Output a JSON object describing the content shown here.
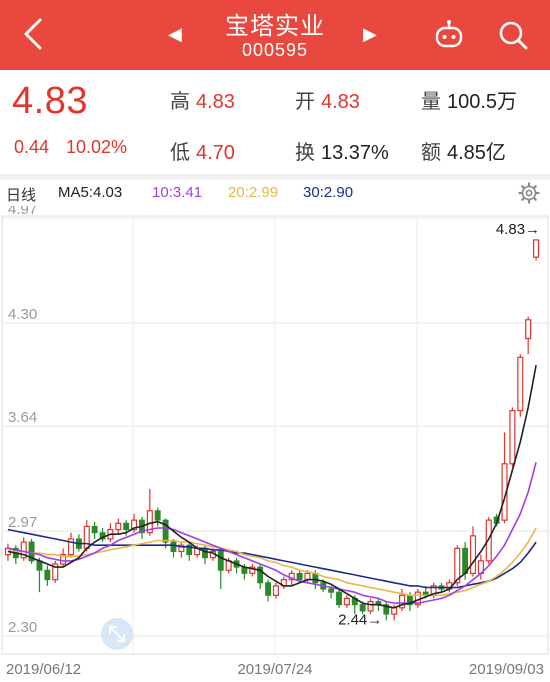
{
  "header": {
    "title": "宝塔实业",
    "code": "000595",
    "prev_glyph": "◀",
    "next_glyph": "▶",
    "icons": [
      "back-arrow-icon",
      "robot-icon",
      "search-icon"
    ],
    "bg_color": "#e8483d"
  },
  "quote": {
    "price": "4.83",
    "change": "0.44",
    "change_pct": "10.02%",
    "high_label": "高",
    "high": "4.83",
    "open_label": "开",
    "open": "4.83",
    "volume_label": "量",
    "volume": "100.5万",
    "low_label": "低",
    "low": "4.70",
    "turnover_label": "换",
    "turnover": "13.37%",
    "amount_label": "额",
    "amount": "4.85亿",
    "up_color": "#e0362b"
  },
  "legend": {
    "period": "日线",
    "ma5": "MA5:4.03",
    "ma10": "10:3.41",
    "ma20": "20:2.99",
    "ma30": "30:2.90",
    "colors": {
      "ma5": "#222222",
      "ma10": "#a23ee8",
      "ma20": "#e8b64a",
      "ma30": "#1e2a8a"
    }
  },
  "chart_data": {
    "type": "candlestick",
    "y_ticks": [
      "4.97",
      "4.30",
      "3.64",
      "2.97",
      "2.30"
    ],
    "ylim": [
      2.3,
      4.97
    ],
    "x_labels": [
      "2019/06/12",
      "2019/07/24",
      "2019/09/03"
    ],
    "annotations": {
      "max": "4.83→",
      "min": "2.44→"
    },
    "up_color": "#e0362b",
    "down_color": "#2a8a2a",
    "candles": [
      [
        2.82,
        2.86,
        2.78,
        2.89
      ],
      [
        2.86,
        2.8,
        2.76,
        2.88
      ],
      [
        2.8,
        2.9,
        2.78,
        2.93
      ],
      [
        2.9,
        2.78,
        2.76,
        2.92
      ],
      [
        2.78,
        2.72,
        2.58,
        2.8
      ],
      [
        2.72,
        2.66,
        2.62,
        2.75
      ],
      [
        2.66,
        2.76,
        2.64,
        2.78
      ],
      [
        2.76,
        2.82,
        2.74,
        2.86
      ],
      [
        2.82,
        2.92,
        2.8,
        2.96
      ],
      [
        2.92,
        2.86,
        2.84,
        2.95
      ],
      [
        2.86,
        3.0,
        2.84,
        3.04
      ],
      [
        3.0,
        2.96,
        2.92,
        3.03
      ],
      [
        2.96,
        2.92,
        2.9,
        2.99
      ],
      [
        2.92,
        2.98,
        2.9,
        3.02
      ],
      [
        2.98,
        3.02,
        2.95,
        3.05
      ],
      [
        3.02,
        2.98,
        2.94,
        3.04
      ],
      [
        2.98,
        3.04,
        2.96,
        3.08
      ],
      [
        3.04,
        2.96,
        2.92,
        3.06
      ],
      [
        2.96,
        3.1,
        2.94,
        3.24
      ],
      [
        3.1,
        3.04,
        3.0,
        3.12
      ],
      [
        3.04,
        2.9,
        2.86,
        3.05
      ],
      [
        2.9,
        2.84,
        2.8,
        2.92
      ],
      [
        2.84,
        2.88,
        2.8,
        2.9
      ],
      [
        2.88,
        2.82,
        2.78,
        2.9
      ],
      [
        2.82,
        2.86,
        2.8,
        2.88
      ],
      [
        2.86,
        2.8,
        2.76,
        2.88
      ],
      [
        2.8,
        2.84,
        2.78,
        2.86
      ],
      [
        2.84,
        2.72,
        2.6,
        2.86
      ],
      [
        2.72,
        2.78,
        2.7,
        2.8
      ],
      [
        2.78,
        2.74,
        2.7,
        2.8
      ],
      [
        2.74,
        2.7,
        2.66,
        2.76
      ],
      [
        2.7,
        2.74,
        2.68,
        2.76
      ],
      [
        2.74,
        2.64,
        2.6,
        2.76
      ],
      [
        2.64,
        2.56,
        2.52,
        2.66
      ],
      [
        2.56,
        2.62,
        2.54,
        2.64
      ],
      [
        2.62,
        2.66,
        2.6,
        2.68
      ],
      [
        2.66,
        2.7,
        2.62,
        2.72
      ],
      [
        2.7,
        2.66,
        2.64,
        2.72
      ],
      [
        2.66,
        2.7,
        2.64,
        2.72
      ],
      [
        2.7,
        2.64,
        2.6,
        2.72
      ],
      [
        2.64,
        2.6,
        2.58,
        2.66
      ],
      [
        2.6,
        2.58,
        2.54,
        2.62
      ],
      [
        2.58,
        2.5,
        2.48,
        2.6
      ],
      [
        2.5,
        2.54,
        2.48,
        2.56
      ],
      [
        2.54,
        2.5,
        2.44,
        2.56
      ],
      [
        2.5,
        2.46,
        2.44,
        2.52
      ],
      [
        2.46,
        2.52,
        2.44,
        2.54
      ],
      [
        2.52,
        2.5,
        2.46,
        2.54
      ],
      [
        2.5,
        2.44,
        2.4,
        2.52
      ],
      [
        2.44,
        2.48,
        2.4,
        2.5
      ],
      [
        2.48,
        2.56,
        2.46,
        2.6
      ],
      [
        2.56,
        2.5,
        2.46,
        2.58
      ],
      [
        2.5,
        2.58,
        2.48,
        2.6
      ],
      [
        2.58,
        2.56,
        2.54,
        2.62
      ],
      [
        2.56,
        2.62,
        2.54,
        2.64
      ],
      [
        2.62,
        2.6,
        2.58,
        2.64
      ],
      [
        2.6,
        2.64,
        2.58,
        2.66
      ],
      [
        2.64,
        2.86,
        2.62,
        2.88
      ],
      [
        2.86,
        2.7,
        2.66,
        2.9
      ],
      [
        2.7,
        2.94,
        2.68,
        3.0
      ],
      [
        2.7,
        2.78,
        2.66,
        2.82
      ],
      [
        2.78,
        3.04,
        2.76,
        3.06
      ],
      [
        3.06,
        3.02,
        3.0,
        3.08
      ],
      [
        3.04,
        3.4,
        3.02,
        3.6
      ],
      [
        3.4,
        3.74,
        3.38,
        3.76
      ],
      [
        3.74,
        4.08,
        3.7,
        4.1
      ],
      [
        4.2,
        4.32,
        4.1,
        4.34
      ],
      [
        4.72,
        4.83,
        4.7,
        4.83
      ]
    ],
    "ma5": [
      2.84,
      2.83,
      2.82,
      2.8,
      2.78,
      2.76,
      2.74,
      2.74,
      2.77,
      2.8,
      2.86,
      2.9,
      2.93,
      2.95,
      2.95,
      2.96,
      2.99,
      3.0,
      3.02,
      3.03,
      3.01,
      2.97,
      2.93,
      2.9,
      2.86,
      2.84,
      2.83,
      2.8,
      2.78,
      2.76,
      2.74,
      2.73,
      2.72,
      2.68,
      2.65,
      2.62,
      2.62,
      2.64,
      2.66,
      2.66,
      2.65,
      2.63,
      2.6,
      2.57,
      2.54,
      2.51,
      2.5,
      2.5,
      2.49,
      2.48,
      2.5,
      2.51,
      2.53,
      2.55,
      2.57,
      2.58,
      2.6,
      2.66,
      2.7,
      2.77,
      2.84,
      2.92,
      3.02,
      3.18,
      3.36,
      3.54,
      3.76,
      4.03
    ],
    "ma10": [
      2.86,
      2.85,
      2.84,
      2.83,
      2.82,
      2.8,
      2.79,
      2.78,
      2.78,
      2.79,
      2.81,
      2.83,
      2.86,
      2.88,
      2.91,
      2.93,
      2.95,
      2.97,
      2.98,
      2.99,
      2.99,
      2.98,
      2.96,
      2.94,
      2.92,
      2.9,
      2.88,
      2.86,
      2.84,
      2.82,
      2.8,
      2.78,
      2.76,
      2.74,
      2.72,
      2.69,
      2.67,
      2.65,
      2.64,
      2.63,
      2.62,
      2.61,
      2.6,
      2.59,
      2.58,
      2.56,
      2.55,
      2.54,
      2.52,
      2.51,
      2.51,
      2.51,
      2.51,
      2.52,
      2.53,
      2.54,
      2.56,
      2.59,
      2.62,
      2.66,
      2.7,
      2.75,
      2.81,
      2.88,
      2.98,
      3.08,
      3.22,
      3.41
    ],
    "ma20": [
      2.84,
      2.84,
      2.84,
      2.83,
      2.83,
      2.82,
      2.82,
      2.81,
      2.81,
      2.81,
      2.82,
      2.83,
      2.84,
      2.85,
      2.86,
      2.87,
      2.88,
      2.89,
      2.9,
      2.91,
      2.91,
      2.91,
      2.9,
      2.9,
      2.89,
      2.88,
      2.87,
      2.86,
      2.85,
      2.84,
      2.82,
      2.81,
      2.8,
      2.78,
      2.77,
      2.75,
      2.74,
      2.72,
      2.71,
      2.7,
      2.68,
      2.67,
      2.66,
      2.64,
      2.63,
      2.62,
      2.61,
      2.6,
      2.59,
      2.58,
      2.57,
      2.56,
      2.56,
      2.56,
      2.56,
      2.56,
      2.57,
      2.58,
      2.59,
      2.61,
      2.63,
      2.65,
      2.68,
      2.72,
      2.77,
      2.83,
      2.9,
      2.99
    ],
    "ma30": [
      2.98,
      2.97,
      2.96,
      2.95,
      2.94,
      2.93,
      2.92,
      2.91,
      2.9,
      2.89,
      2.89,
      2.88,
      2.88,
      2.88,
      2.88,
      2.88,
      2.88,
      2.88,
      2.88,
      2.88,
      2.88,
      2.88,
      2.87,
      2.87,
      2.86,
      2.86,
      2.85,
      2.85,
      2.84,
      2.83,
      2.83,
      2.82,
      2.81,
      2.8,
      2.79,
      2.78,
      2.77,
      2.76,
      2.75,
      2.74,
      2.73,
      2.72,
      2.71,
      2.7,
      2.69,
      2.68,
      2.67,
      2.66,
      2.65,
      2.64,
      2.63,
      2.62,
      2.62,
      2.61,
      2.61,
      2.61,
      2.61,
      2.61,
      2.62,
      2.63,
      2.64,
      2.65,
      2.67,
      2.7,
      2.73,
      2.77,
      2.83,
      2.9
    ]
  }
}
